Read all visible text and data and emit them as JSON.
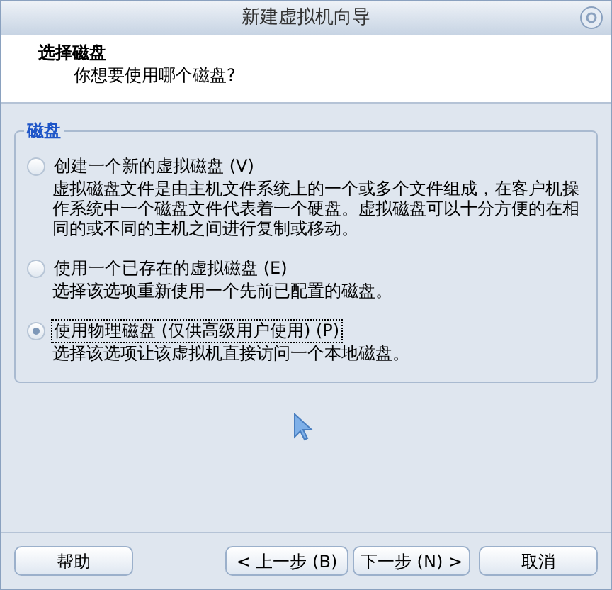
{
  "window": {
    "title": "新建虚拟机向导"
  },
  "header": {
    "title": "选择磁盘",
    "subtitle": "你想要使用哪个磁盘?"
  },
  "group": {
    "title": "磁盘",
    "options": [
      {
        "label": "创建一个新的虚拟磁盘 (V)",
        "description": "虚拟磁盘文件是由主机文件系统上的一个或多个文件组成，在客户机操作系统中一个磁盘文件代表着一个硬盘。虚拟磁盘可以十分方便的在相同的或不同的主机之间进行复制或移动。",
        "selected": false
      },
      {
        "label": "使用一个已存在的虚拟磁盘 (E)",
        "description": "选择该选项重新使用一个先前已配置的磁盘。",
        "selected": false
      },
      {
        "label": "使用物理磁盘 (仅供高级用户使用) (P)",
        "description": "选择该选项让该虚拟机直接访问一个本地磁盘。",
        "selected": true
      }
    ]
  },
  "buttons": {
    "help": "帮助",
    "back": "< 上一步 (B)",
    "next": "下一步 (N) >",
    "cancel": "取消"
  }
}
